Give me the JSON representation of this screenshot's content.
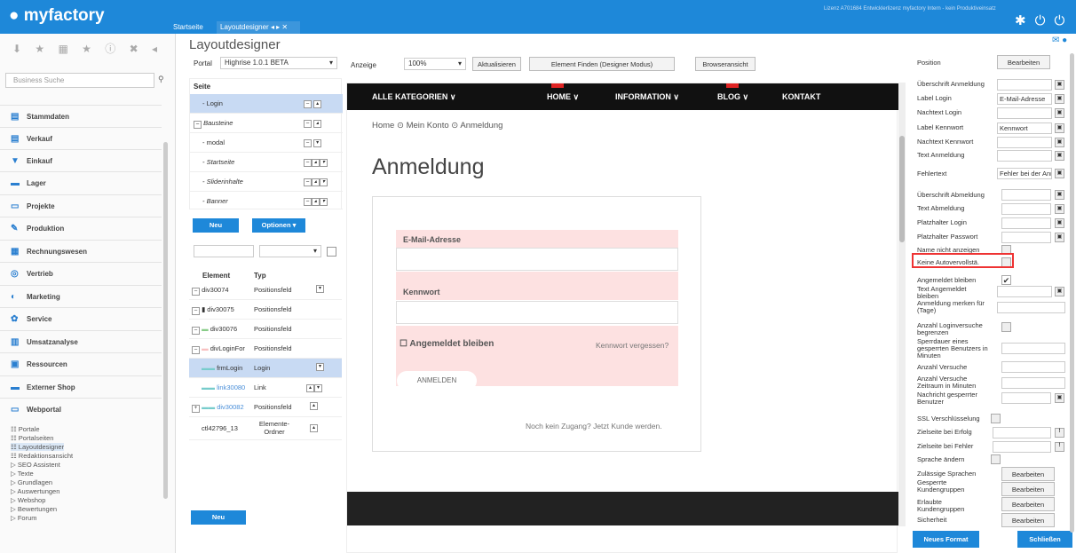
{
  "app": {
    "logo": "myfactory",
    "license": "Lizenz A701684 Entwicklerlizenz myfactory Intern - kein Produktiveinsatz"
  },
  "tabs": [
    {
      "label": "Startseite"
    },
    {
      "label": "Layoutdesigner"
    }
  ],
  "sidebar": {
    "search_placeholder": "Business Suche",
    "items": [
      {
        "label": "Stammdaten"
      },
      {
        "label": "Verkauf"
      },
      {
        "label": "Einkauf"
      },
      {
        "label": "Lager"
      },
      {
        "label": "Projekte"
      },
      {
        "label": "Produktion"
      },
      {
        "label": "Rechnungswesen"
      },
      {
        "label": "Vertrieb"
      },
      {
        "label": "Marketing"
      },
      {
        "label": "Service"
      },
      {
        "label": "Umsatzanalyse"
      },
      {
        "label": "Ressourcen"
      },
      {
        "label": "Externer Shop"
      },
      {
        "label": "Webportal"
      }
    ],
    "subitems": [
      {
        "label": "☷ Portale"
      },
      {
        "label": "☷ Portalseiten"
      },
      {
        "label": "☷ Layoutdesigner"
      },
      {
        "label": "☷ Redaktionsansicht"
      },
      {
        "label": "▷ SEO Assistent"
      },
      {
        "label": "▷ Texte"
      },
      {
        "label": "▷ Grundlagen"
      },
      {
        "label": "▷ Auswertungen"
      },
      {
        "label": "▷ Webshop"
      },
      {
        "label": "▷ Bewertungen"
      },
      {
        "label": "▷ Forum"
      }
    ]
  },
  "main": {
    "title": "Layoutdesigner",
    "portal_label": "Portal",
    "portal_value": "Highrise 1.0.1 BETA",
    "anzeige_label": "Anzeige",
    "zoom": "100%",
    "refresh": "Aktualisieren",
    "find_element": "Element Finden (Designer Modus)",
    "browser_view": "Browseransicht",
    "tree_header": "Seite",
    "tree_rows": [
      {
        "label": "- Login"
      },
      {
        "label": "Bausteine"
      },
      {
        "label": "- modal"
      },
      {
        "label": "- Startseite"
      },
      {
        "label": "- Sliderinhalte"
      },
      {
        "label": "- Banner"
      }
    ],
    "new_btn": "Neu",
    "options_btn": "Optionen",
    "elem_header_element": "Element",
    "elem_header_type": "Typ",
    "elem_rows": [
      {
        "id": "div30074",
        "type": "Positionsfeld"
      },
      {
        "id": "div30075",
        "type": "Positionsfeld"
      },
      {
        "id": "div30076",
        "type": "Positionsfeld"
      },
      {
        "id": "divLoginFor",
        "type": "Positionsfeld"
      },
      {
        "id": "frmLogin",
        "type": "Login"
      },
      {
        "id": "link30080",
        "type": "Link"
      },
      {
        "id": "div30082",
        "type": "Positionsfeld"
      },
      {
        "id": "ctl42796_13",
        "type": "Elemente-Ordner"
      }
    ],
    "new_btn2": "Neu"
  },
  "preview": {
    "nav": [
      "ALLE KATEGORIEN ∨",
      "HOME ∨",
      "INFORMATION ∨",
      "BLOG ∨",
      "KONTAKT"
    ],
    "breadcrumb": "Home  ⊙  Mein Konto  ⊙  Anmeldung",
    "heading": "Anmeldung",
    "email_label": "E-Mail-Adresse",
    "password_label": "Kennwort",
    "remember": "Angemeldet bleiben",
    "forgot": "Kennwort vergessen?",
    "login_btn": "ANMELDEN",
    "no_access": "Noch kein Zugang? Jetzt Kunde werden."
  },
  "props": {
    "position_label": "Position",
    "edit": "Bearbeiten",
    "fields": [
      {
        "label": "Überschrift Anmeldung",
        "value": ""
      },
      {
        "label": "Label Login",
        "value": "E-Mail-Adresse"
      },
      {
        "label": "Nachtext Login",
        "value": ""
      },
      {
        "label": "Label Kennwort",
        "value": "Kennwort"
      },
      {
        "label": "Nachtext Kennwort",
        "value": ""
      },
      {
        "label": "Text Anmeldung",
        "value": ""
      },
      {
        "label": "Fehlertext",
        "value": "Fehler bei der Anm"
      },
      {
        "label": "Überschrift Abmeldung",
        "value": ""
      },
      {
        "label": "Text Abmeldung",
        "value": ""
      },
      {
        "label": "Platzhalter Login",
        "value": ""
      },
      {
        "label": "Platzhalter Passwort",
        "value": ""
      },
      {
        "label": "Name nicht anzeigen",
        "value": ""
      },
      {
        "label": "Keine Autovervollstä.",
        "value": ""
      },
      {
        "label": "Angemeldet bleiben",
        "value": ""
      },
      {
        "label": "Text Angemeldet bleiben",
        "value": ""
      },
      {
        "label": "Anmeldung merken für (Tage)",
        "value": ""
      },
      {
        "label": "Anzahl Loginversuche begrenzen",
        "value": ""
      },
      {
        "label": "Sperrdauer eines gesperrten Benutzers in Minuten",
        "value": ""
      },
      {
        "label": "Anzahl Versuche",
        "value": ""
      },
      {
        "label": "Anzahl Versuche Zeitraum in Minuten",
        "value": ""
      },
      {
        "label": "Nachricht gesperrter Benutzer",
        "value": ""
      },
      {
        "label": "SSL Verschlüsselung",
        "value": ""
      },
      {
        "label": "Zielseite bei Erfolg",
        "value": ""
      },
      {
        "label": "Zielseite bei Fehler",
        "value": ""
      },
      {
        "label": "Sprache ändern",
        "value": ""
      },
      {
        "label": "Zulässige Sprachen",
        "value": ""
      },
      {
        "label": "Gesperrte Kundengruppen",
        "value": ""
      },
      {
        "label": "Erlaubte Kundengruppen",
        "value": ""
      },
      {
        "label": "Sicherheit",
        "value": ""
      }
    ],
    "new_format": "Neues Format",
    "close": "Schließen"
  }
}
